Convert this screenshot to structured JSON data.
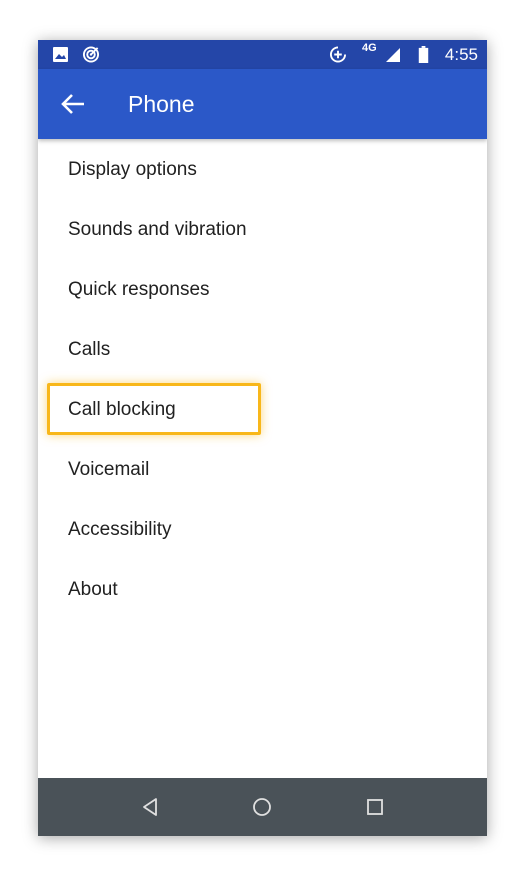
{
  "status_bar": {
    "time": "4:55",
    "network": "4G",
    "left_icons": [
      "image-icon",
      "radar-icon"
    ],
    "right_icons": [
      "data-saver-icon",
      "signal-icon",
      "battery-icon"
    ]
  },
  "app_bar": {
    "title": "Phone",
    "back_icon": "arrow-left-icon"
  },
  "menu": {
    "items": [
      {
        "label": "Display options"
      },
      {
        "label": "Sounds and vibration"
      },
      {
        "label": "Quick responses"
      },
      {
        "label": "Calls"
      },
      {
        "label": "Call blocking",
        "highlighted": true
      },
      {
        "label": "Voicemail"
      },
      {
        "label": "Accessibility"
      },
      {
        "label": "About"
      }
    ]
  },
  "nav_bar": {
    "buttons": [
      "back-triangle-icon",
      "home-circle-icon",
      "recents-square-icon"
    ]
  },
  "colors": {
    "status_bar": "#2446a8",
    "app_bar": "#2b58c8",
    "highlight": "#f8b71a",
    "nav_bar": "#4a5258"
  }
}
